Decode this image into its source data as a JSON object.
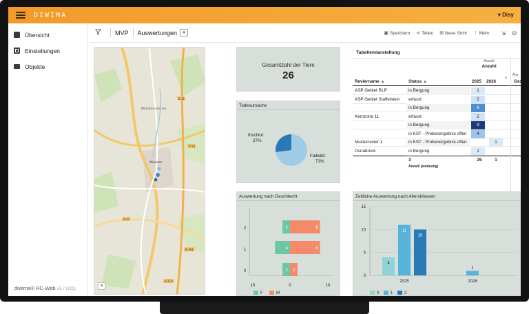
{
  "app": {
    "brand": "DIWIMA",
    "user": "▾ Disy",
    "version_label": "diwima® RC-Web",
    "version_num": "v3.7 (223)"
  },
  "sidebar": {
    "items": [
      {
        "label": "Übersicht",
        "icon": "dashboard-icon"
      },
      {
        "label": "Einstellungen",
        "icon": "settings-icon"
      },
      {
        "label": "Objekte",
        "icon": "objects-icon"
      }
    ]
  },
  "toolbar": {
    "breadcrumb_root": "MVP",
    "view_title": "Auswertungen",
    "save_label": "Speichern",
    "share_label": "Teilen",
    "new_view_label": "Neue Sicht",
    "more_label": "Mehr"
  },
  "map": {
    "labels": [
      "Münster",
      "Münstersche Aa",
      "B 51",
      "B 54",
      "A 43",
      "B 481",
      "B 219"
    ]
  },
  "kpi": {
    "label": "Gesamtzahl der Tiere",
    "value": "26"
  },
  "pie": {
    "title": "Todesursache",
    "slices": [
      {
        "label": "frischtot:",
        "pct": "27%",
        "value": 27,
        "color": "#2a78b7"
      },
      {
        "label": "Fallwild:",
        "pct": "73%",
        "value": 73,
        "color": "#9fcbe6"
      }
    ]
  },
  "table": {
    "title": "Tabellendarstellung",
    "col_revier": "Reviername",
    "col_status": "Status",
    "group_small": "Anzahl",
    "group_big": "Anzahl",
    "group_small_cut": "Anz",
    "year_2025": "2025",
    "year_2026": "2026",
    "col_ges_cut": "Ges",
    "rows": [
      {
        "revier": "ASP Gebiet RLP",
        "status": "in Bergung",
        "v2025": "1",
        "v2026": "",
        "shade": "#dce9f6",
        "fg": "#222"
      },
      {
        "revier": "ASP Gebiet Staffelstein",
        "status": "erfasst",
        "v2025": "2",
        "v2026": "",
        "shade": "#cfe1f2",
        "fg": "#222"
      },
      {
        "revier": "",
        "status": "in Bergung",
        "v2025": "6",
        "v2026": "",
        "shade": "#4b8fd1",
        "fg": "#fff"
      },
      {
        "revier": "Kernzone 11",
        "status": "erfasst",
        "v2025": "2",
        "v2026": "",
        "shade": "#cfe1f2",
        "fg": "#222"
      },
      {
        "revier": "",
        "status": "in Bergung",
        "v2025": "9",
        "v2026": "",
        "shade": "#1d3a78",
        "fg": "#fff"
      },
      {
        "revier": "",
        "status": "in KST - Probenergebnis offen",
        "v2025": "4",
        "v2026": "",
        "shade": "#9cc3e8",
        "fg": "#222"
      },
      {
        "revier": "Musterrevier 1",
        "status": "in KST - Probenergebnis offen",
        "v2025": "",
        "v2026": "1",
        "shade": "#dce9f6",
        "fg": "#222"
      },
      {
        "revier": "Osnabrück",
        "status": "in Bergung",
        "v2025": "1",
        "v2026": "",
        "shade": "#dce9f6",
        "fg": "#222"
      }
    ],
    "total_count": "3",
    "total_label": "Anzahl (eindeutig)",
    "total_2025": "25",
    "total_2026": "1"
  },
  "chart_data": [
    {
      "type": "bar",
      "title": "Auswertung nach Geschlecht",
      "orientation": "horizontal-diverging",
      "categories": [
        "2",
        "1",
        "0"
      ],
      "series": [
        {
          "name": "F",
          "values": [
            2,
            4,
            2
          ],
          "color": "#6cc7a2"
        },
        {
          "name": "M",
          "values": [
            8,
            8,
            2
          ],
          "color": "#f58a6b"
        }
      ],
      "xticks": [
        "10",
        "0",
        "10"
      ],
      "xlim": [
        -10,
        10
      ]
    },
    {
      "type": "bar",
      "title": "Zeitliche Auswertung nach Altersklassen",
      "categories": [
        "2025",
        "2026"
      ],
      "series": [
        {
          "name": "0",
          "values": [
            4,
            0
          ],
          "color": "#8fd3d8"
        },
        {
          "name": "1",
          "values": [
            11,
            1
          ],
          "color": "#57b3dc"
        },
        {
          "name": "2",
          "values": [
            10,
            0
          ],
          "color": "#2a7bb5"
        }
      ],
      "yticks": [
        "0",
        "5",
        "10",
        "15"
      ],
      "ylim": [
        0,
        15
      ]
    }
  ]
}
